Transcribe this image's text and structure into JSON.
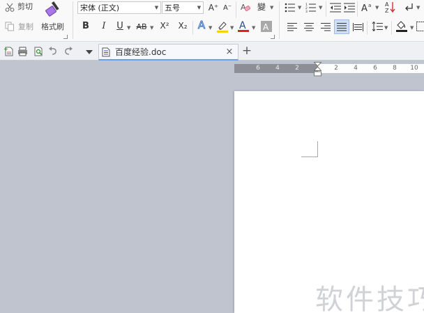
{
  "ribbon": {
    "clipboard": {
      "cut_label": "剪切",
      "copy_label": "复制",
      "format_painter_label": "格式刷"
    },
    "font": {
      "font_name": "宋体 (正文)",
      "font_size": "五号",
      "bold_label": "B",
      "italic_label": "I",
      "underline_label": "U",
      "strike_label": "AB",
      "superscript_label": "X²",
      "subscript_label": "X₂",
      "text_effect_label": "A",
      "font_color_label": "A",
      "char_shading_label": "A",
      "grow_label": "A⁺",
      "shrink_label": "A⁻",
      "phonetic_label": "變"
    }
  },
  "tabs": {
    "doc_tab_label": "百度经验.doc",
    "close_glyph": "×",
    "new_tab_glyph": "+"
  },
  "ruler": {
    "left_numbers": [
      "6",
      "4",
      "2"
    ],
    "right_numbers": [
      "2",
      "4",
      "6",
      "8",
      "10"
    ]
  },
  "watermark": {
    "text": "软件技巧"
  },
  "colors": {
    "workspace_bg": "#c0c4ce",
    "highlighter": "#f5d400",
    "font_color_bar": "#e0201a",
    "text_effect": "#3d74c9",
    "active_tab_border": "#6d9ee0",
    "format_painter": "#8a4bd1"
  }
}
